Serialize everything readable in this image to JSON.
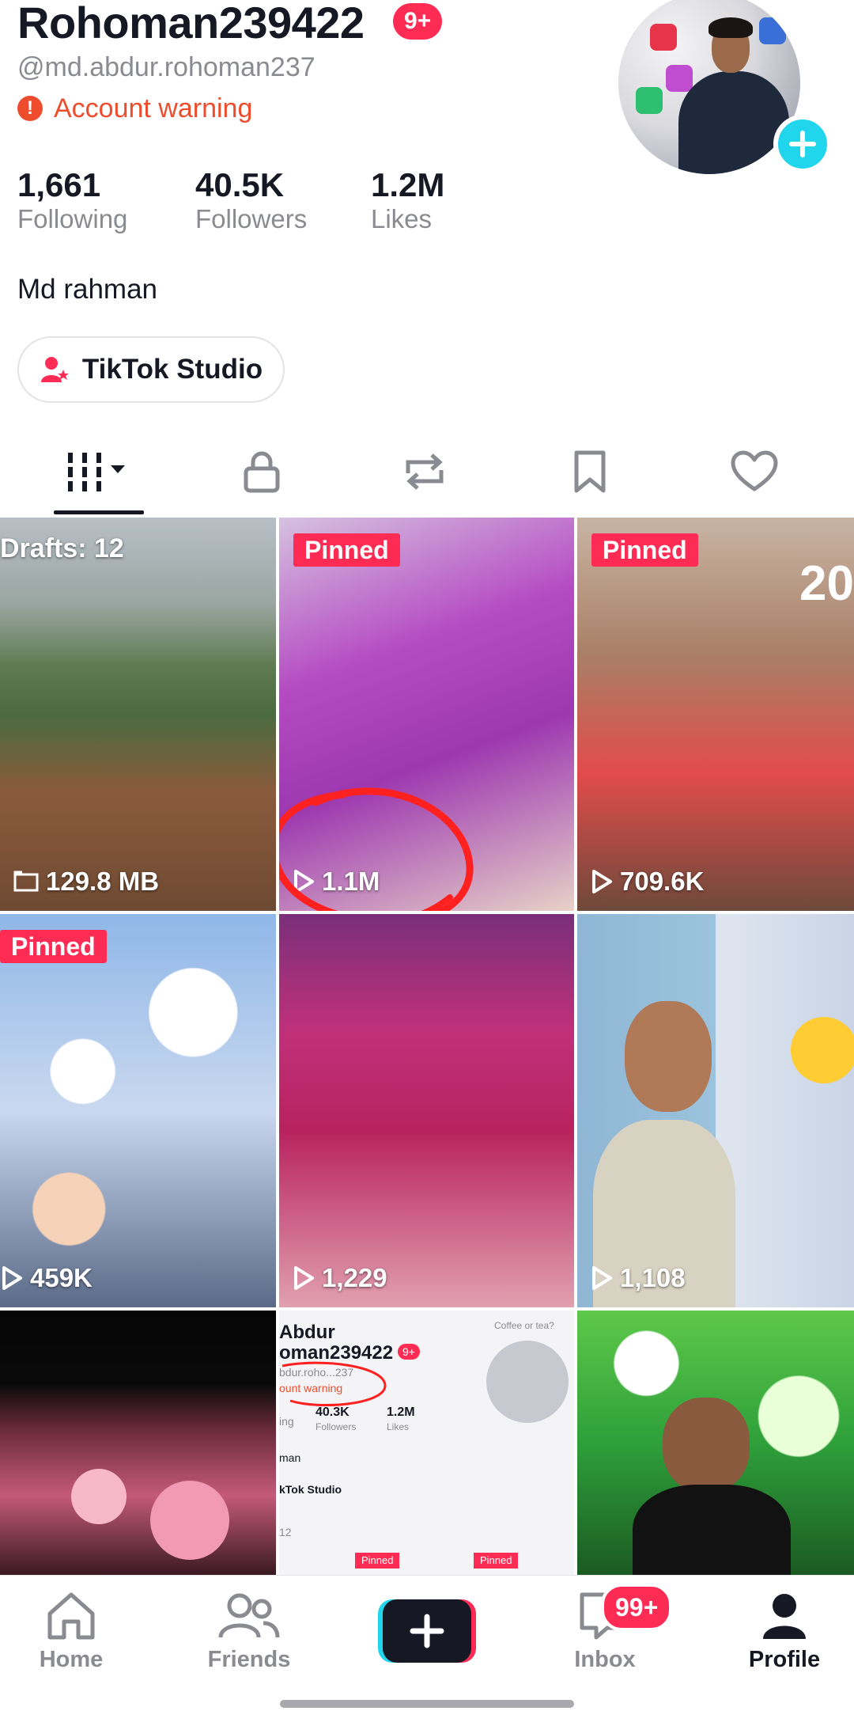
{
  "profile": {
    "username": "Rohoman239422",
    "notification_badge": "9+",
    "handle": "@md.abdur.rohoman237",
    "warning_text": "Account warning",
    "bio": "Md rahman"
  },
  "stats": [
    {
      "value": "1,661",
      "label": "Following"
    },
    {
      "value": "40.5K",
      "label": "Followers"
    },
    {
      "value": "1.2M",
      "label": "Likes"
    }
  ],
  "studio_button": {
    "label": "TikTok Studio"
  },
  "tabs": [
    {
      "name": "videos",
      "icon": "grid-bars-icon",
      "active": true
    },
    {
      "name": "private",
      "icon": "lock-icon"
    },
    {
      "name": "reposts",
      "icon": "repost-icon"
    },
    {
      "name": "favorites",
      "icon": "bookmark-icon"
    },
    {
      "name": "liked",
      "icon": "heart-icon"
    }
  ],
  "grid": [
    {
      "drafts_label": "Drafts: 12",
      "size_label": "129.8 MB"
    },
    {
      "pinned": "Pinned",
      "views": "1.1M"
    },
    {
      "pinned": "Pinned",
      "views": "709.6K",
      "overlay_text": "20"
    },
    {
      "pinned": "Pinned",
      "views": "459K"
    },
    {
      "views": "1,229"
    },
    {
      "views": "1,108"
    },
    {},
    {
      "thumbnail_text": {
        "name_line1": "Abdur",
        "name_line2": "oman239422",
        "badge": "9+",
        "handle": "bdur.roho...237",
        "warning": "ount warning",
        "coffee": "Coffee or tea?",
        "followers": "40.3K",
        "followers_label": "Followers",
        "likes": "1.2M",
        "likes_label": "Likes",
        "following_label": "ing",
        "bio": "man",
        "studio": "kTok Studio",
        "pinned": "Pinned",
        "row_label": "12"
      }
    },
    {}
  ],
  "bottom_nav": {
    "home": "Home",
    "friends": "Friends",
    "inbox": "Inbox",
    "inbox_badge": "99+",
    "profile": "Profile"
  },
  "colors": {
    "accent": "#fe2c55",
    "warning": "#ee4d2d",
    "cyan": "#20d5ec",
    "text": "#161823",
    "muted": "#8a8b91"
  }
}
